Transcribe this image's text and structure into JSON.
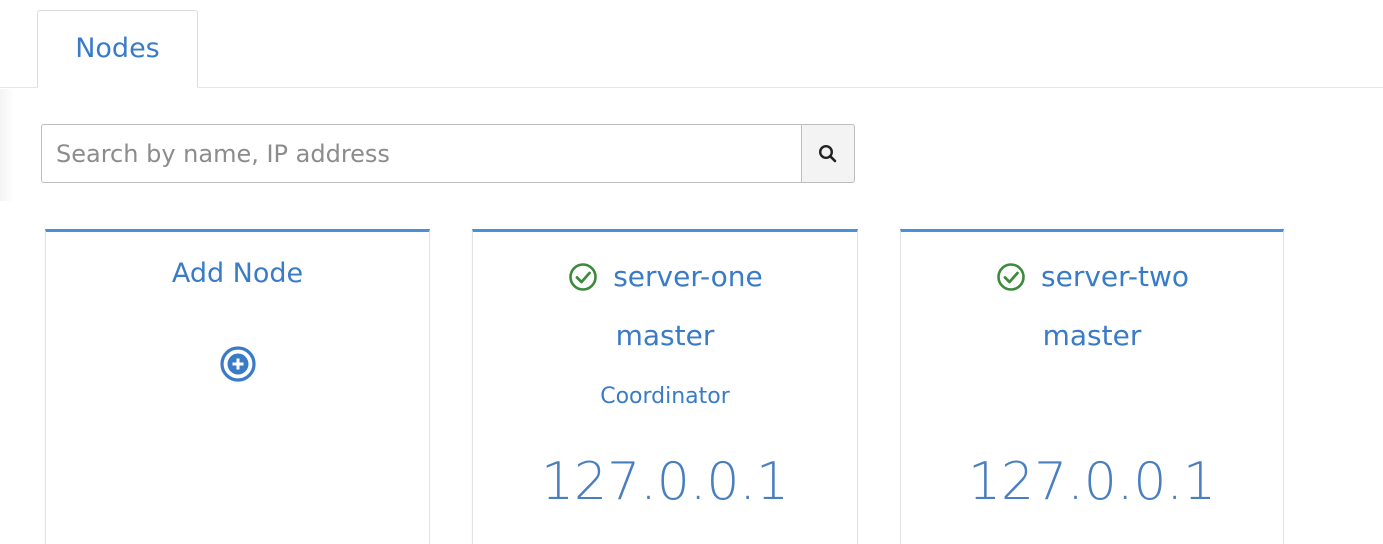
{
  "tabs": [
    {
      "label": "Nodes",
      "active": true
    }
  ],
  "search": {
    "placeholder": "Search by name, IP address",
    "value": "",
    "button_icon": "search-icon"
  },
  "cards": {
    "add": {
      "title": "Add Node",
      "icon": "plus-circle-icon"
    },
    "nodes": [
      {
        "name": "server-one",
        "status_icon": "check-circle-icon",
        "status_color": "#3c8a3c",
        "role": "master",
        "tag": "Coordinator",
        "ip": "127.0.0.1"
      },
      {
        "name": "server-two",
        "status_icon": "check-circle-icon",
        "status_color": "#3c8a3c",
        "role": "master",
        "tag": "",
        "ip": "127.0.0.1"
      }
    ]
  },
  "colors": {
    "accent": "#3a7bc8",
    "card_border_top": "#4a90d9",
    "status_ok": "#3c8a3c"
  }
}
